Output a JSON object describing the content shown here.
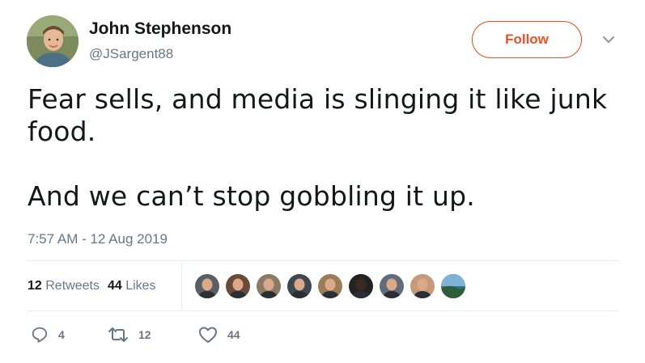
{
  "author": {
    "name": "John Stephenson",
    "handle": "@JSargent88",
    "avatar_icon": "avatar-photo"
  },
  "follow_button": {
    "label": "Follow",
    "color": "#f04e23"
  },
  "menu_icon": "chevron-down-icon",
  "tweet": {
    "text": "Fear sells, and media is slinging it like junk\nfood.\n\nAnd we can’t stop gobbling it up.",
    "timestamp": "7:57 AM - 12 Aug 2019"
  },
  "stats": {
    "retweets_count": "12",
    "retweets_label": "Retweets",
    "likes_count": "44",
    "likes_label": "Likes"
  },
  "likers": [
    {
      "icon": "liker-avatar-1",
      "color": "#5b5f63"
    },
    {
      "icon": "liker-avatar-2",
      "color": "#6b4a3a"
    },
    {
      "icon": "liker-avatar-3",
      "color": "#8a7a66"
    },
    {
      "icon": "liker-avatar-4",
      "color": "#3f4750"
    },
    {
      "icon": "liker-avatar-5",
      "color": "#9a7b5a"
    },
    {
      "icon": "liker-avatar-6",
      "color": "#232323"
    },
    {
      "icon": "liker-avatar-7",
      "color": "#5e6d78"
    },
    {
      "icon": "liker-avatar-8",
      "color": "#c49a7a"
    },
    {
      "icon": "liker-avatar-9",
      "color": "#2f6f8f"
    }
  ],
  "actions": {
    "reply": {
      "icon": "reply-icon",
      "count": "4"
    },
    "retweet": {
      "icon": "retweet-icon",
      "count": "12"
    },
    "like": {
      "icon": "heart-icon",
      "count": "44"
    }
  }
}
